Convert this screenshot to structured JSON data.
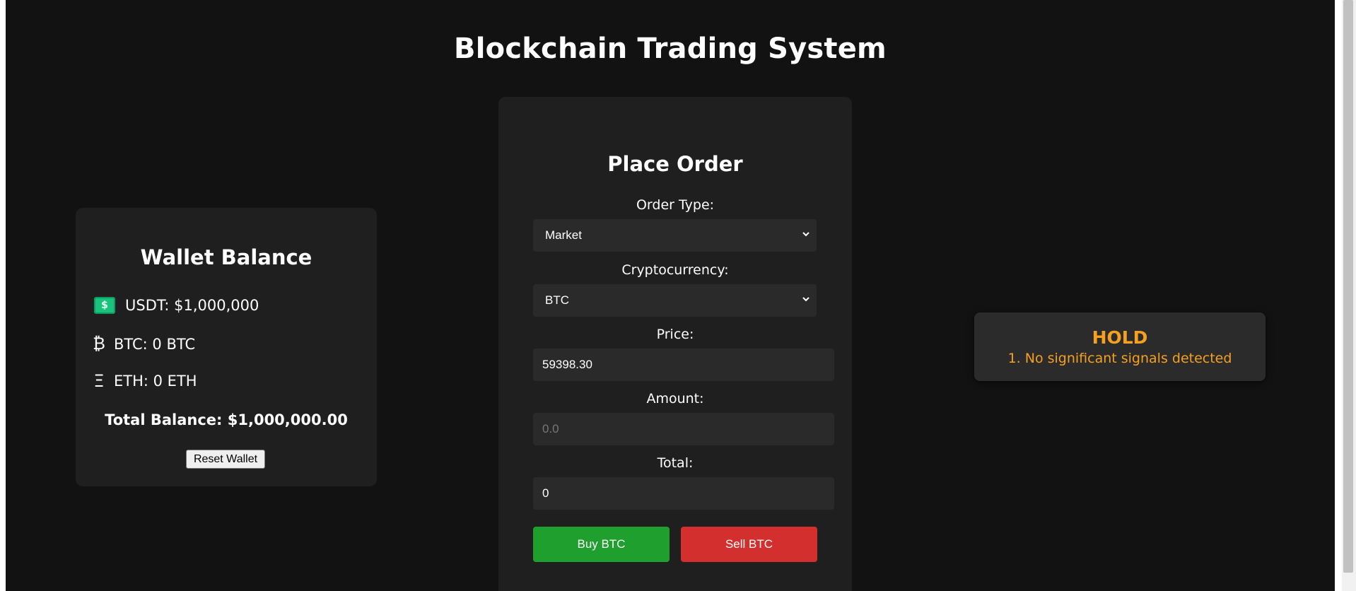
{
  "page": {
    "title": "Blockchain Trading System"
  },
  "wallet": {
    "title": "Wallet Balance",
    "items": [
      {
        "icon": "cash-icon",
        "label": "USDT: $1,000,000"
      },
      {
        "icon": "bitcoin-icon",
        "glyph": "₿",
        "label": "BTC: 0 BTC"
      },
      {
        "icon": "ethereum-icon",
        "glyph": "Ξ",
        "label": "ETH: 0 ETH"
      }
    ],
    "total_label": "Total Balance: $1,000,000.00",
    "reset_label": "Reset Wallet"
  },
  "order": {
    "title": "Place Order",
    "order_type": {
      "label": "Order Type:",
      "value": "Market"
    },
    "cryptocurrency": {
      "label": "Cryptocurrency:",
      "value": "BTC"
    },
    "price": {
      "label": "Price:",
      "value": "59398.30"
    },
    "amount": {
      "label": "Amount:",
      "value": "",
      "placeholder": "0.0"
    },
    "total": {
      "label": "Total:",
      "value": "0"
    },
    "buy_label": "Buy BTC",
    "sell_label": "Sell BTC"
  },
  "signal": {
    "title": "HOLD",
    "reason": "1. No significant signals detected",
    "color": "#f5a020"
  },
  "colors": {
    "background": "#121212",
    "card": "#1f1f1f",
    "buy": "#1e9f2e",
    "sell": "#d32f2f"
  }
}
